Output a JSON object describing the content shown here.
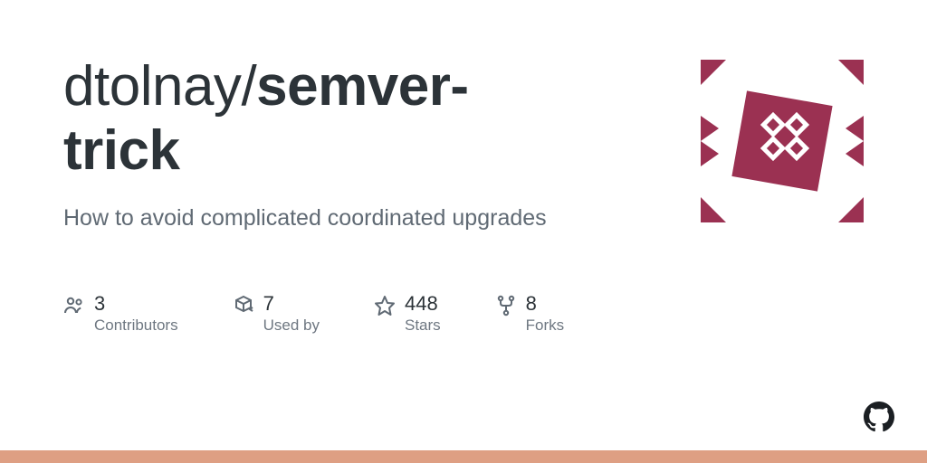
{
  "repo": {
    "owner": "dtolnay",
    "separator": "/",
    "name_part1": "semver",
    "name_hyphen": "-",
    "name_part2": "trick"
  },
  "description": "How to avoid complicated coordinated upgrades",
  "stats": {
    "contributors": {
      "value": "3",
      "label": "Contributors"
    },
    "used_by": {
      "value": "7",
      "label": "Used by"
    },
    "stars": {
      "value": "448",
      "label": "Stars"
    },
    "forks": {
      "value": "8",
      "label": "Forks"
    }
  },
  "colors": {
    "accent": "#9b3152",
    "bar": "#de9f83"
  }
}
